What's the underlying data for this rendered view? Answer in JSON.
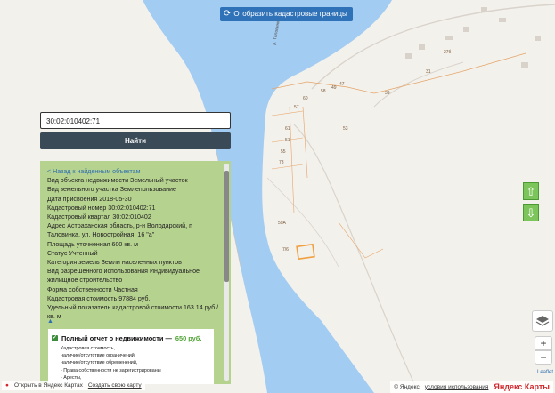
{
  "top_button": {
    "icon": "refresh-icon",
    "label": "Отобразить кадастровые границы"
  },
  "search": {
    "value": "30:02:010402:71"
  },
  "find_button": {
    "label": "Найти"
  },
  "info": {
    "back_link": "< Назад к найденным объектам",
    "lines": [
      "Вид объекта недвижимости Земельный участок",
      "Вид земельного участка Землепользование",
      "Дата присвоения 2018-05-30",
      "Кадастровый номер 30:02:010402:71",
      "Кадастровый квартал 30:02:010402",
      "Адрес Астраханская область, р-н Володарский, п Таловинка, ул. Новостройная, 16 \"а\"",
      "Площадь уточненная 600 кв. м",
      "Статус Учтенный",
      "Категория земель Земли населенных пунктов",
      "Вид разрешенного использования Индивидуальное жилищное строительство",
      "Форма собственности Частная",
      "Кадастровая стоимость 97884 руб.",
      "Удельный показатель кадастровой стоимости 163.14 руб / кв. м"
    ],
    "expand": "▲"
  },
  "report": {
    "title": "Полный отчет о недвижимости —",
    "price": "650 руб.",
    "items": [
      "Кадастровая стоимость,",
      "наличие/отсутствие ограничений,",
      "наличие/отсутствие обременений,",
      "- Права собственности не зарегистрированы",
      "- Аресты,"
    ]
  },
  "map_labels": {
    "road": "р. Таловинка",
    "numbers": [
      "57",
      "60",
      "58",
      "54",
      "49",
      "47",
      "39",
      "31",
      "27б",
      "53",
      "61",
      "51",
      "57",
      "55",
      "59",
      "73",
      "59А",
      "7/6"
    ]
  },
  "controls": {
    "up": "⇧",
    "down": "⇩",
    "layers": "layers-icon",
    "zoom_in": "+",
    "zoom_out": "−"
  },
  "footer": {
    "open_in": "Открыть в Яндекс Картах",
    "create_map": "Создать свою карту",
    "copyright": "© Яндекс",
    "terms": "условия использования",
    "brand": "Яндекс Карты",
    "leaflet": "Leaflet"
  },
  "colors": {
    "river": "#a3ccf2",
    "land": "#f3f1ec",
    "panel": "#b6d28f",
    "accent": "#2f72b8",
    "parcel": "#f0a040"
  }
}
